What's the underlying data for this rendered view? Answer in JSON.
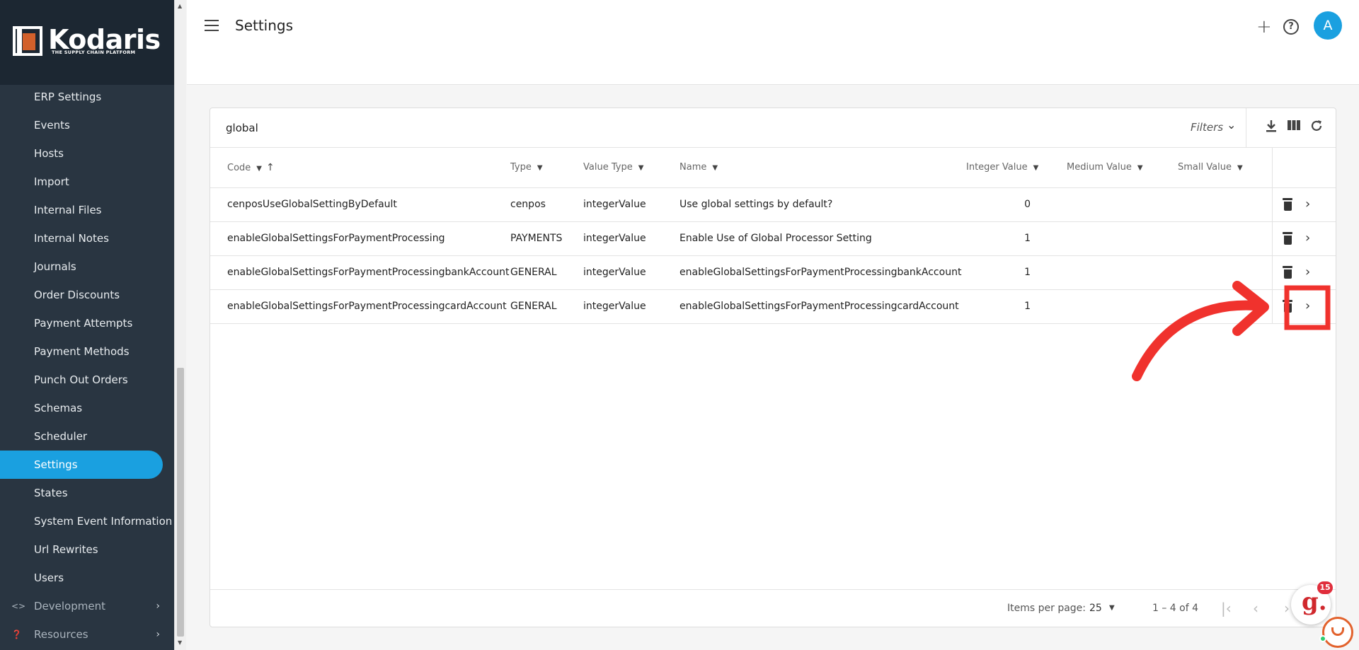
{
  "brand": {
    "name": "Kodaris",
    "tagline": "THE SUPPLY CHAIN PLATFORM"
  },
  "sidebar": {
    "items": [
      {
        "label": "ERP Settings"
      },
      {
        "label": "Events"
      },
      {
        "label": "Hosts"
      },
      {
        "label": "Import"
      },
      {
        "label": "Internal Files"
      },
      {
        "label": "Internal Notes"
      },
      {
        "label": "Journals"
      },
      {
        "label": "Order Discounts"
      },
      {
        "label": "Payment Attempts"
      },
      {
        "label": "Payment Methods"
      },
      {
        "label": "Punch Out Orders"
      },
      {
        "label": "Schemas"
      },
      {
        "label": "Scheduler"
      },
      {
        "label": "Settings",
        "active": true
      },
      {
        "label": "States"
      },
      {
        "label": "System Event Information"
      },
      {
        "label": "Url Rewrites"
      },
      {
        "label": "Users"
      }
    ],
    "groups": [
      {
        "label": "Development",
        "icon": "code-icon"
      },
      {
        "label": "Resources",
        "icon": "help-circle-icon"
      }
    ]
  },
  "header": {
    "title": "Settings"
  },
  "search": {
    "value": "global"
  },
  "toolbar": {
    "filters_label": "Filters"
  },
  "table": {
    "columns": [
      "Code",
      "Type",
      "Value Type",
      "Name",
      "Integer Value",
      "Medium Value",
      "Small Value"
    ],
    "rows": [
      {
        "code": "cenposUseGlobalSettingByDefault",
        "type": "cenpos",
        "value_type": "integerValue",
        "name": "Use global settings by default?",
        "integer_value": "0",
        "medium_value": "",
        "small_value": ""
      },
      {
        "code": "enableGlobalSettingsForPaymentProcessing",
        "type": "PAYMENTS",
        "value_type": "integerValue",
        "name": "Enable Use of Global Processor Setting",
        "integer_value": "1",
        "medium_value": "",
        "small_value": ""
      },
      {
        "code": "enableGlobalSettingsForPaymentProcessingbankAccount",
        "type": "GENERAL",
        "value_type": "integerValue",
        "name": "enableGlobalSettingsForPaymentProcessingbankAccount",
        "integer_value": "1",
        "medium_value": "",
        "small_value": ""
      },
      {
        "code": "enableGlobalSettingsForPaymentProcessingcardAccount",
        "type": "GENERAL",
        "value_type": "integerValue",
        "name": "enableGlobalSettingsForPaymentProcessingcardAccount",
        "integer_value": "1",
        "medium_value": "",
        "small_value": ""
      }
    ]
  },
  "pagination": {
    "items_per_page_label": "Items per page:",
    "items_per_page": "25",
    "range": "1 – 4 of 4"
  },
  "chat": {
    "badge_count": "15"
  },
  "colors": {
    "sidebar_bg": "#293541",
    "accent": "#1aa0e0",
    "annotation": "#f0322d",
    "logo_orange": "#d2602b"
  }
}
